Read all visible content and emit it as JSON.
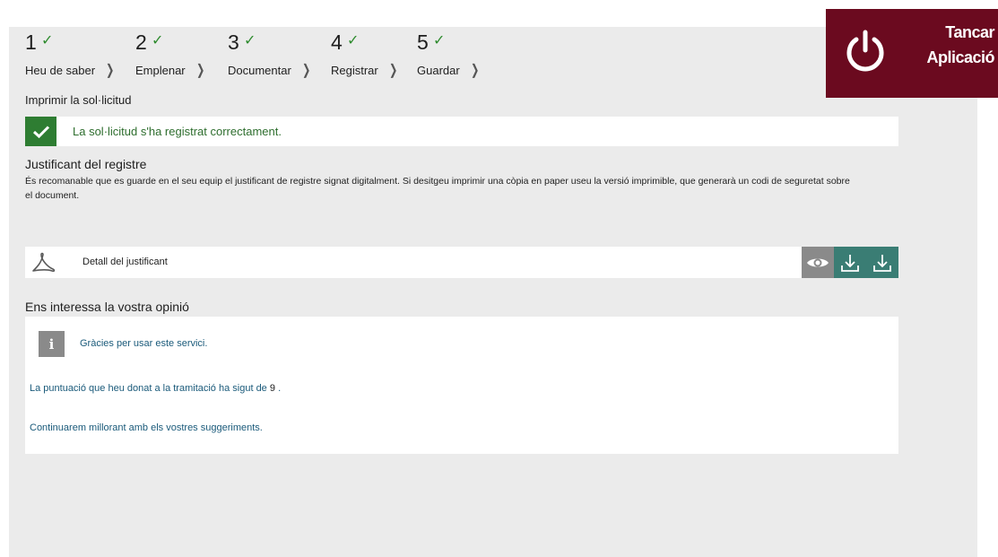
{
  "steps": [
    {
      "number": "1",
      "label": "Heu de saber"
    },
    {
      "number": "2",
      "label": "Emplenar"
    },
    {
      "number": "3",
      "label": "Documentar"
    },
    {
      "number": "4",
      "label": "Registrar"
    },
    {
      "number": "5",
      "label": "Guardar"
    }
  ],
  "close_app": {
    "line1": "Tancar",
    "line2": "Aplicació",
    "icon": "power-icon"
  },
  "print_title": "Imprimir la sol·licitud",
  "success_message": "La sol·licitud s'ha registrat correctament.",
  "justificant": {
    "title": "Justificant del registre",
    "description": "És recomanable que es guarde en el seu equip el justificant de registre signat digitalment. Si desitgeu imprimir una còpia en paper useu la versió imprimible, que generarà un codi de seguretat sobre el document."
  },
  "file": {
    "label": "Detall del justificant",
    "icon": "pdf-icon"
  },
  "opinion": {
    "title": "Ens interessa la vostra opinió",
    "thanks": "Gràcies per usar este servici.",
    "score_prefix": "La puntuació que heu donat a la tramitació ha sigut de",
    "score_value": "9",
    "score_suffix": ".",
    "continue": "Continuarem millorant amb els vostres suggeriments."
  },
  "colors": {
    "success": "#2e7d32",
    "close_app_bg": "#6b0a1f",
    "download_bg": "#3a7d74",
    "view_bg": "#8a8a8a",
    "link_text": "#1a5a7a"
  }
}
